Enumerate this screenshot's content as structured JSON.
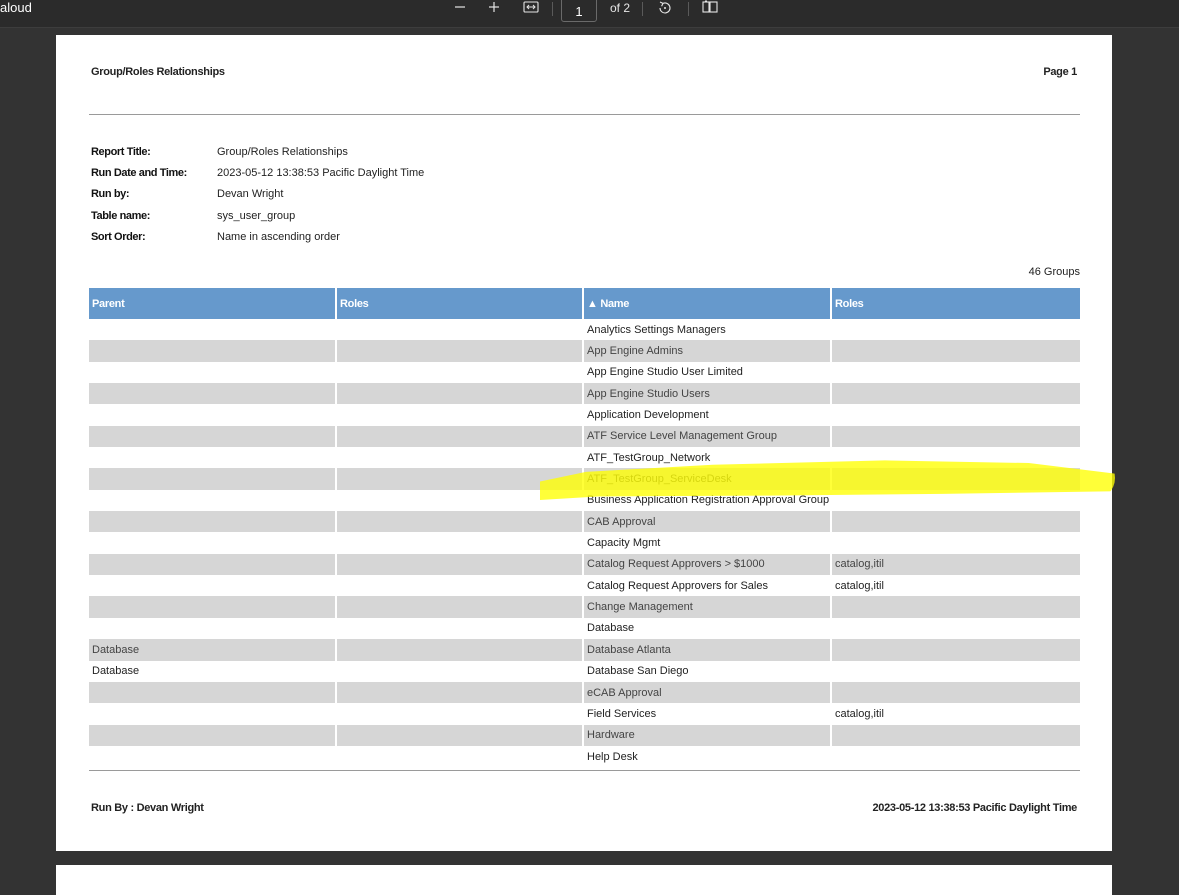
{
  "toolbar": {
    "title": "aloud",
    "page_value": "1",
    "page_of": "of 2"
  },
  "header": {
    "title": "Group/Roles Relationships",
    "page": "Page 1"
  },
  "meta": [
    {
      "label": "Report Title:",
      "value": "Group/Roles Relationships"
    },
    {
      "label": "Run Date and Time:",
      "value": "2023-05-12 13:38:53 Pacific Daylight Time"
    },
    {
      "label": "Run by:",
      "value": "Devan Wright"
    },
    {
      "label": "Table name:",
      "value": "sys_user_group"
    },
    {
      "label": "Sort Order:",
      "value": "Name in ascending order"
    }
  ],
  "count": "46 Groups",
  "table": {
    "headers": [
      "Parent",
      "Roles",
      "▲ Name",
      "Roles"
    ],
    "rows": [
      [
        "",
        "",
        "Analytics Settings Managers",
        ""
      ],
      [
        "",
        "",
        "App Engine Admins",
        ""
      ],
      [
        "",
        "",
        "App Engine Studio User Limited",
        ""
      ],
      [
        "",
        "",
        "App Engine Studio Users",
        ""
      ],
      [
        "",
        "",
        "Application Development",
        ""
      ],
      [
        "",
        "",
        "ATF Service Level Management  Group",
        ""
      ],
      [
        "",
        "",
        "ATF_TestGroup_Network",
        ""
      ],
      [
        "",
        "",
        "ATF_TestGroup_ServiceDesk",
        ""
      ],
      [
        "",
        "",
        "Business Application Registration Approval Group",
        ""
      ],
      [
        "",
        "",
        "CAB Approval",
        ""
      ],
      [
        "",
        "",
        "Capacity Mgmt",
        ""
      ],
      [
        "",
        "",
        "Catalog Request Approvers > $1000",
        "catalog,itil"
      ],
      [
        "",
        "",
        "Catalog Request Approvers for Sales",
        "catalog,itil"
      ],
      [
        "",
        "",
        "Change Management",
        ""
      ],
      [
        "",
        "",
        "Database",
        ""
      ],
      [
        "Database",
        "",
        "Database Atlanta",
        ""
      ],
      [
        "Database",
        "",
        "Database San Diego",
        ""
      ],
      [
        "",
        "",
        "eCAB Approval",
        ""
      ],
      [
        "",
        "",
        "Field Services",
        "catalog,itil"
      ],
      [
        "",
        "",
        "Hardware",
        ""
      ],
      [
        "",
        "",
        "Help Desk",
        ""
      ]
    ]
  },
  "footer": {
    "left": "Run By : Devan Wright",
    "right": "2023-05-12 13:38:53 Pacific Daylight Time"
  },
  "colors": {
    "header_bg": "#6699cc",
    "stripe": "#d6d6d6",
    "highlight": "#ffff00",
    "viewer_bg": "#333333"
  }
}
